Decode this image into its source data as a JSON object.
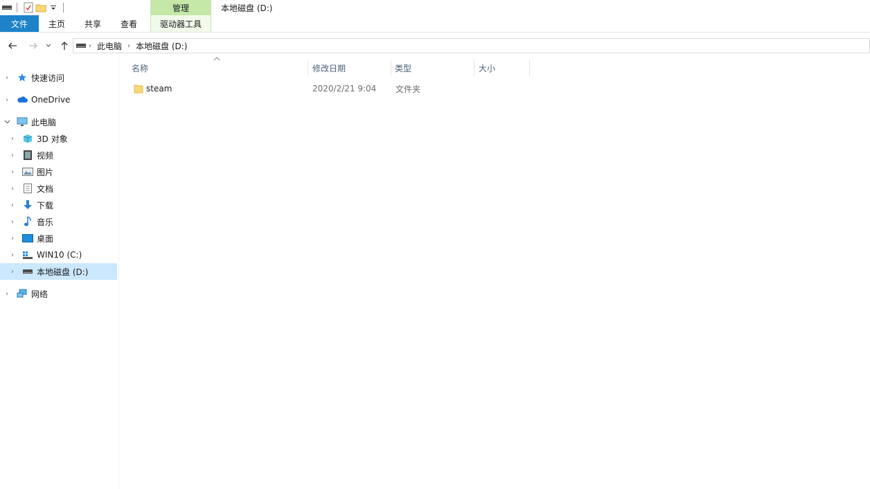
{
  "window": {
    "title": "本地磁盘 (D:)",
    "context_tab_header": "管理"
  },
  "ribbon": {
    "tabs": [
      {
        "label": "文件"
      },
      {
        "label": "主页"
      },
      {
        "label": "共享"
      },
      {
        "label": "查看"
      }
    ],
    "context_tab": "驱动器工具"
  },
  "address": {
    "crumbs": [
      "此电脑",
      "本地磁盘 (D:)"
    ]
  },
  "sidebar": {
    "items": [
      {
        "label": "快速访问",
        "icon": "star-icon"
      },
      {
        "label": "OneDrive",
        "icon": "cloud-icon"
      },
      {
        "label": "此电脑",
        "icon": "computer-icon"
      },
      {
        "label": "3D 对象",
        "icon": "cube-icon"
      },
      {
        "label": "视频",
        "icon": "video-icon"
      },
      {
        "label": "图片",
        "icon": "picture-icon"
      },
      {
        "label": "文档",
        "icon": "document-icon"
      },
      {
        "label": "下载",
        "icon": "download-icon"
      },
      {
        "label": "音乐",
        "icon": "music-icon"
      },
      {
        "label": "桌面",
        "icon": "desktop-icon"
      },
      {
        "label": "WIN10 (C:)",
        "icon": "windows-drive-icon"
      },
      {
        "label": "本地磁盘 (D:)",
        "icon": "drive-icon"
      },
      {
        "label": "网络",
        "icon": "network-icon"
      }
    ]
  },
  "file_list": {
    "columns": [
      "名称",
      "修改日期",
      "类型",
      "大小"
    ],
    "rows": [
      {
        "name": "steam",
        "modified": "2020/2/21 9:04",
        "type": "文件夹",
        "size": ""
      }
    ]
  },
  "colors": {
    "file_tab": "#1d82c9",
    "context_header": "#c5e8a8",
    "selection": "#cce8ff"
  }
}
